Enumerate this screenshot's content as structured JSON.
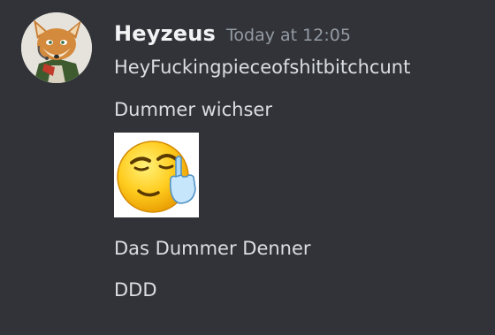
{
  "message": {
    "author": "Heyzeus",
    "timestamp": "Today at 12:05",
    "avatar_icon": "fox-avatar-icon",
    "lines": [
      "HeyFuckingpieceofshitbitchcunt",
      "Dummer wichser",
      "Das Dummer Denner",
      "DDD"
    ],
    "attachment_icon": "middle-finger-emoji-icon"
  },
  "colors": {
    "background": "#313338",
    "username": "#f2f3f5",
    "timestamp": "#949ba4",
    "text": "#dbdee1"
  }
}
